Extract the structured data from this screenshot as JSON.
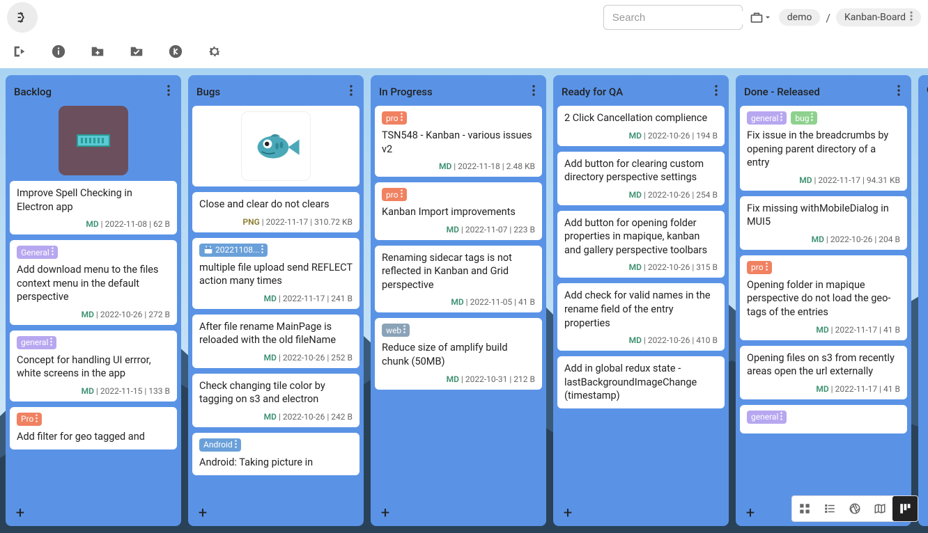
{
  "header": {
    "search_placeholder": "Search",
    "breadcrumbs": [
      "demo",
      "Kanban-Board"
    ]
  },
  "tag_colors": {
    "General": "#b7a7f0",
    "general": "#b7a7f0",
    "Pro": "#f08161",
    "pro": "#f08161",
    "web": "#8aa3b8",
    "bug": "#8ed18e",
    "Android": "#6aa0d9",
    "date": "#6aa0d9"
  },
  "columns": [
    {
      "title": "Backlog",
      "hasThumb": "1",
      "cards": [
        {
          "title": "Improve Spell Checking in Electron app",
          "ext": "MD",
          "date": "2022-11-08",
          "size": "62 B",
          "tags": []
        },
        {
          "title": "Add download menu to the files context menu in the default perspective",
          "ext": "MD",
          "date": "2022-10-26",
          "size": "272 B",
          "tags": [
            "General"
          ]
        },
        {
          "title": "Concept for handling UI errror, white screens in the app",
          "ext": "MD",
          "date": "2022-11-15",
          "size": "133 B",
          "tags": [
            "general"
          ]
        },
        {
          "title": "Add filter for geo tagged and",
          "ext": "",
          "date": "",
          "size": "",
          "tags": [
            "Pro"
          ]
        }
      ]
    },
    {
      "title": "Bugs",
      "hasThumb": "2",
      "cards": [
        {
          "title": "Close and clear do not clears",
          "ext": "PNG",
          "date": "2022-11-17",
          "size": "310.72 KB",
          "tags": []
        },
        {
          "title": "multiple file upload send REFLECT action many times",
          "ext": "MD",
          "date": "2022-11-17",
          "size": "241 B",
          "tags": [
            "20221108..."
          ],
          "tagIsDate": true
        },
        {
          "title": "After file rename MainPage is reloaded with the old fileName",
          "ext": "MD",
          "date": "2022-10-26",
          "size": "252 B",
          "tags": []
        },
        {
          "title": "Check changing tile color by tagging on s3 and electron",
          "ext": "MD",
          "date": "2022-10-26",
          "size": "242 B",
          "tags": []
        },
        {
          "title": "Android: Taking picture in",
          "ext": "",
          "date": "",
          "size": "",
          "tags": [
            "Android"
          ]
        }
      ]
    },
    {
      "title": "In Progress",
      "cards": [
        {
          "title": "TSN548 - Kanban - various issues v2",
          "ext": "MD",
          "date": "2022-11-18",
          "size": "2.48 KB",
          "tags": [
            "pro"
          ]
        },
        {
          "title": "Kanban Import improvements",
          "ext": "MD",
          "date": "2022-11-07",
          "size": "223 B",
          "tags": [
            "pro"
          ]
        },
        {
          "title": "Renaming sidecar tags is not reflected in Kanban and Grid perspective",
          "ext": "MD",
          "date": "2022-11-05",
          "size": "41 B",
          "tags": []
        },
        {
          "title": "Reduce size of amplify build chunk (50MB)",
          "ext": "MD",
          "date": "2022-10-31",
          "size": "212 B",
          "tags": [
            "web"
          ]
        }
      ]
    },
    {
      "title": "Ready for QA",
      "cards": [
        {
          "title": "2 Click Cancellation complience",
          "ext": "MD",
          "date": "2022-10-26",
          "size": "194 B",
          "tags": []
        },
        {
          "title": "Add button for clearing custom directory perspective settings",
          "ext": "MD",
          "date": "2022-10-26",
          "size": "254 B",
          "tags": []
        },
        {
          "title": "Add button for opening folder properties in mapique, kanban and gallery perspective toolbars",
          "ext": "MD",
          "date": "2022-10-26",
          "size": "315 B",
          "tags": []
        },
        {
          "title": "Add check for valid names in the rename field of the entry properties",
          "ext": "MD",
          "date": "2022-10-26",
          "size": "410 B",
          "tags": []
        },
        {
          "title": "Add in global redux state - lastBackgroundImageChange (timestamp)",
          "ext": "",
          "date": "",
          "size": "",
          "tags": []
        }
      ]
    },
    {
      "title": "Done - Released",
      "cards": [
        {
          "title": "Fix issue in the breadcrumbs by opening parent directory of a entry",
          "ext": "MD",
          "date": "2022-11-17",
          "size": "94.31 KB",
          "tags": [
            "general",
            "bug"
          ]
        },
        {
          "title": "Fix missing withMobileDialog in MUI5",
          "ext": "MD",
          "date": "2022-10-26",
          "size": "204 B",
          "tags": []
        },
        {
          "title": "Opening folder in mapique perspective do not load the geo-tags of the entries",
          "ext": "MD",
          "date": "2022-11-17",
          "size": "41 B",
          "tags": [
            "pro"
          ]
        },
        {
          "title": "Opening files on s3 from recently areas open the url externally",
          "ext": "MD",
          "date": "2022-11-17",
          "size": "41 B",
          "tags": []
        },
        {
          "title": "",
          "ext": "",
          "date": "",
          "size": "",
          "tags": [
            "general"
          ]
        }
      ]
    }
  ],
  "peek_column": {
    "title": "O"
  }
}
